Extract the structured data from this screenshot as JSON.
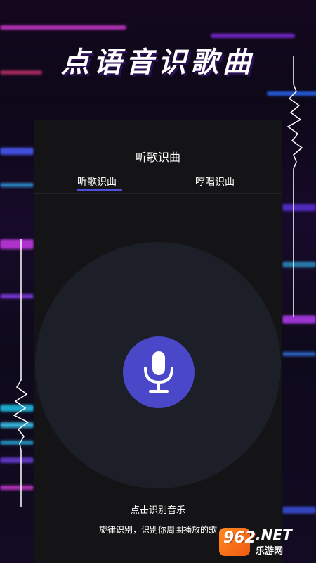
{
  "promo": {
    "headline": "点语音识歌曲"
  },
  "screen": {
    "title": "听歌识曲",
    "tabs": [
      {
        "label": "听歌识曲",
        "active": true
      },
      {
        "label": "哼唱识曲",
        "active": false
      }
    ],
    "record": {
      "icon": "microphone-icon",
      "action_title": "点击识别音乐",
      "action_desc": "旋律识别，识别你周围播放的歌"
    }
  },
  "watermark": {
    "number": "962",
    "net": ".NET",
    "site": "乐游网"
  },
  "colors": {
    "accent": "#4a47c9",
    "tab_indicator": "#5858ff",
    "panel_bg": "#141416",
    "circle_bg": "#1d1f28",
    "watermark_orange": "#f05a13"
  }
}
